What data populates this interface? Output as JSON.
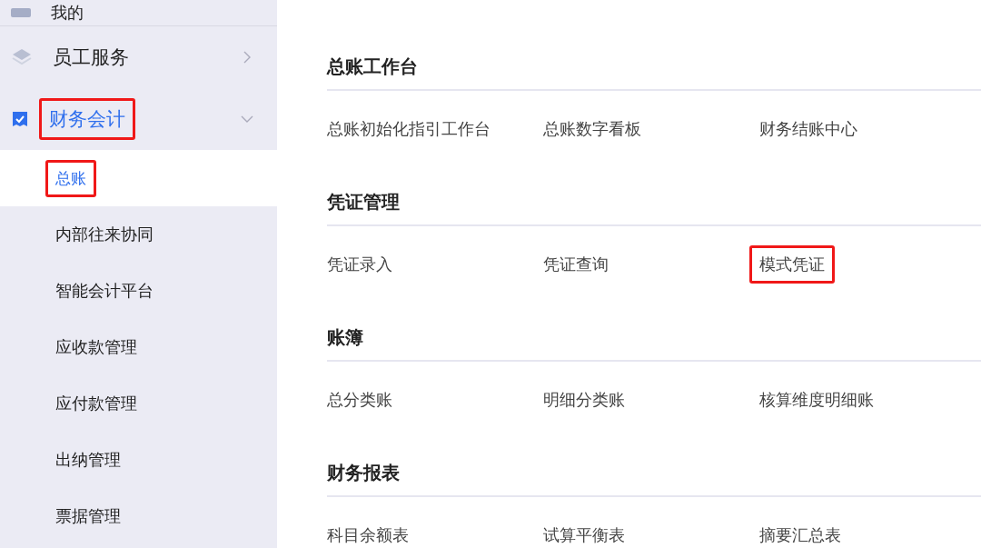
{
  "sidebar": {
    "items": [
      {
        "label": "我的",
        "kind": "plain",
        "selected": false,
        "highlighted": false
      },
      {
        "label": "员工服务",
        "kind": "group",
        "expanded": false,
        "selected": false,
        "highlighted": false
      },
      {
        "label": "财务会计",
        "kind": "group",
        "expanded": true,
        "selected": true,
        "highlighted": true,
        "children": [
          {
            "label": "总账",
            "selected": true,
            "highlighted": true
          },
          {
            "label": "内部往来协同",
            "selected": false,
            "highlighted": false
          },
          {
            "label": "智能会计平台",
            "selected": false,
            "highlighted": false
          },
          {
            "label": "应收款管理",
            "selected": false,
            "highlighted": false
          },
          {
            "label": "应付款管理",
            "selected": false,
            "highlighted": false
          },
          {
            "label": "出纳管理",
            "selected": false,
            "highlighted": false
          },
          {
            "label": "票据管理",
            "selected": false,
            "highlighted": false
          }
        ]
      }
    ]
  },
  "sections": [
    {
      "title": "总账工作台",
      "items": [
        {
          "label": "总账初始化指引工作台",
          "highlighted": false
        },
        {
          "label": "总账数字看板",
          "highlighted": false
        },
        {
          "label": "财务结账中心",
          "highlighted": false
        }
      ]
    },
    {
      "title": "凭证管理",
      "items": [
        {
          "label": "凭证录入",
          "highlighted": false
        },
        {
          "label": "凭证查询",
          "highlighted": false
        },
        {
          "label": "模式凭证",
          "highlighted": true
        }
      ]
    },
    {
      "title": "账簿",
      "items": [
        {
          "label": "总分类账",
          "highlighted": false
        },
        {
          "label": "明细分类账",
          "highlighted": false
        },
        {
          "label": "核算维度明细账",
          "highlighted": false
        }
      ]
    },
    {
      "title": "财务报表",
      "items": [
        {
          "label": "科目余额表",
          "highlighted": false
        },
        {
          "label": "试算平衡表",
          "highlighted": false
        },
        {
          "label": "摘要汇总表",
          "highlighted": false
        }
      ]
    }
  ]
}
